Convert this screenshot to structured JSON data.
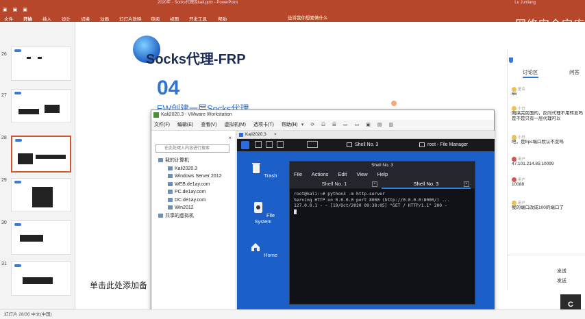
{
  "ppt": {
    "title": "2020年 - Socks代理及kali.pptx - PowerPoint",
    "user": "Lu Junliang",
    "tabs": [
      "文件",
      "开始",
      "插入",
      "设计",
      "切换",
      "动画",
      "幻灯片放映",
      "审阅",
      "视图",
      "开发工具",
      "帮助"
    ],
    "help": "告诉我你想要做什么",
    "watermark": "网络安全宝库"
  },
  "thumbnails": [
    {
      "num": "26"
    },
    {
      "num": "27"
    },
    {
      "num": "28"
    },
    {
      "num": "29"
    },
    {
      "num": "30"
    },
    {
      "num": "31"
    }
  ],
  "slide": {
    "title": "Socks代理-FRP",
    "number": "04",
    "subtitle": "EW创建一层Socks代理",
    "notes_hint": "单击此处添加备"
  },
  "vmware": {
    "title": "Kali2020.3 - VMware Workstation",
    "menu": [
      "文件(F)",
      "编辑(E)",
      "查看(V)",
      "虚拟机(M)",
      "选项卡(T)",
      "帮助(H)"
    ],
    "library_search": "在此处键入内容进行搜索",
    "tree": [
      {
        "label": "我的计算机",
        "level": 1
      },
      {
        "label": "Kali2020.3",
        "level": 2
      },
      {
        "label": "Windows Server 2012",
        "level": 2
      },
      {
        "label": "WEB.de1ay.com",
        "level": 2
      },
      {
        "label": "PC.de1ay.com",
        "level": 2
      },
      {
        "label": "DC.de1ay.com",
        "level": 2
      },
      {
        "label": "Win2012",
        "level": 2
      },
      {
        "label": "共享的虚拟机",
        "level": 1
      }
    ],
    "guest_tab": "Kali2020.3"
  },
  "kali": {
    "tasks": [
      "Shell No. 3",
      "root - File Manager"
    ],
    "desktop": [
      {
        "label": "Trash"
      },
      {
        "label": "File System"
      },
      {
        "label": "Home"
      }
    ]
  },
  "terminal": {
    "title": "Shell No. 3",
    "menu": [
      "File",
      "Actions",
      "Edit",
      "View",
      "Help"
    ],
    "tabs": [
      "Shell No. 1",
      "Shell No. 3"
    ],
    "lines": [
      "root@kali:~# python3 -m http.server",
      "Serving HTTP on 0.0.0.0 port 8000 (http://0.0.0.0:8000/) ...",
      "127.0.0.1 - - [19/Oct/2020 09:38:05] \"GET / HTTP/1.1\" 200 -"
    ]
  },
  "comments": {
    "tabs": [
      "讨论区",
      "问答"
    ],
    "items": [
      {
        "user": "匿名",
        "text": "66"
      },
      {
        "user": "小白",
        "text": "刚搞完前面的，反向代理不用转发吗"
      },
      {
        "user": "小白",
        "text": "是不是只有一层代理可以"
      },
      {
        "user": "小白",
        "text": "吧，是frps端口默认不变吗"
      },
      {
        "user": "用户",
        "text": "47.101.214.85:10099"
      },
      {
        "user": "用户",
        "text": "10088"
      },
      {
        "user": "用户",
        "text": "我的端口改成100的端口了"
      }
    ],
    "send": "发送",
    "send_btn": "发送"
  },
  "statusbar": "幻灯片 28/36   中文(中国)",
  "c_button": "C"
}
